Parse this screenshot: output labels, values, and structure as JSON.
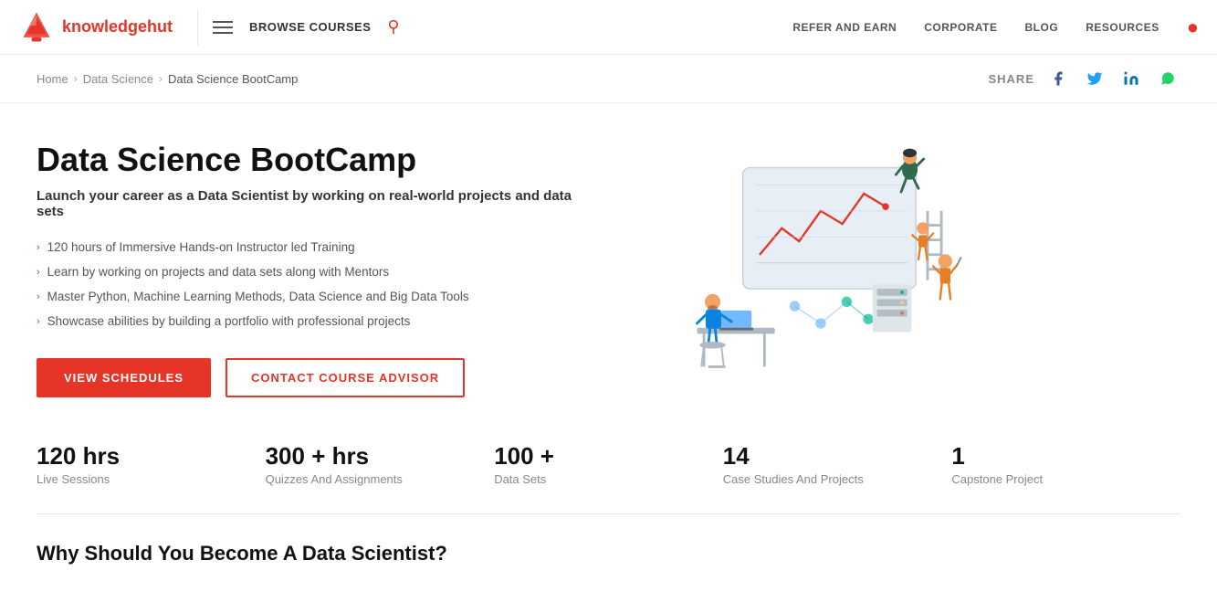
{
  "header": {
    "logo_text": "knowledgehut",
    "browse_courses_label": "BROWSE COURSES",
    "nav_links": [
      {
        "label": "REFER AND EARN",
        "id": "refer-earn"
      },
      {
        "label": "CORPORATE",
        "id": "corporate"
      },
      {
        "label": "BLOG",
        "id": "blog"
      },
      {
        "label": "RESOURCES",
        "id": "resources"
      }
    ]
  },
  "breadcrumb": {
    "home": "Home",
    "parent": "Data Science",
    "current": "Data Science BootCamp"
  },
  "share": {
    "label": "SHARE"
  },
  "hero": {
    "title": "Data Science BootCamp",
    "subtitle": "Launch your career as a Data Scientist by working on real-world projects and data sets",
    "features": [
      "120 hours of Immersive Hands-on Instructor led Training",
      "Learn by working on projects and data sets along with Mentors",
      "Master Python, Machine Learning Methods, Data Science and Big Data Tools",
      "Showcase abilities by building a portfolio with professional projects"
    ],
    "btn_primary": "VIEW SCHEDULES",
    "btn_outline": "CONTACT COURSE ADVISOR"
  },
  "stats": [
    {
      "number": "120 hrs",
      "label": "Live Sessions"
    },
    {
      "number": "300 + hrs",
      "label": "Quizzes And Assignments"
    },
    {
      "number": "100 +",
      "label": "Data Sets"
    },
    {
      "number": "14",
      "label": "Case Studies And Projects"
    },
    {
      "number": "1",
      "label": "Capstone Project"
    }
  ],
  "bottom": {
    "title": "Why Should You Become A Data Scientist?"
  },
  "colors": {
    "brand_red": "#e63527",
    "text_dark": "#111111",
    "text_muted": "#888888"
  }
}
